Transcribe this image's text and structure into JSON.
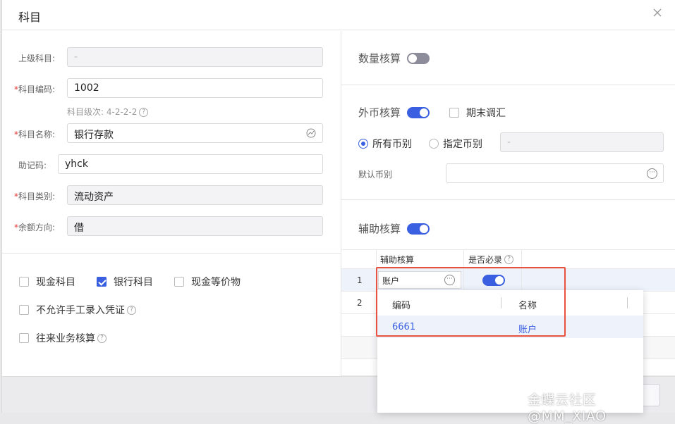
{
  "dialog": {
    "title": "科目"
  },
  "form": {
    "parent": {
      "label": "上级科目:",
      "value": "-"
    },
    "code": {
      "label": "科目编码:",
      "value": "1002",
      "hint": "科目级次: 4-2-2-2"
    },
    "name": {
      "label": "科目名称:",
      "value": "银行存款"
    },
    "mnemonic": {
      "label": "助记码:",
      "value": "yhck"
    },
    "category": {
      "label": "科目类别:",
      "value": "流动资产"
    },
    "balance": {
      "label": "余额方向:",
      "value": "借"
    },
    "required_mark": "*"
  },
  "checks": {
    "cash": {
      "label": "现金科目",
      "checked": false
    },
    "bank": {
      "label": "银行科目",
      "checked": true
    },
    "cash_eq": {
      "label": "现金等价物",
      "checked": false
    },
    "no_manual": {
      "label": "不允许手工录入凭证",
      "checked": false
    },
    "ar_ap": {
      "label": "往来业务核算",
      "checked": false
    }
  },
  "right": {
    "quantity": {
      "label": "数量核算",
      "on": false
    },
    "foreign": {
      "label": "外币核算",
      "on": true
    },
    "period_adjust": {
      "label": "期末调汇",
      "checked": false
    },
    "all_currency": {
      "label": "所有币别",
      "selected": true
    },
    "specific_currency": {
      "label": "指定币别",
      "selected": false,
      "value": "-"
    },
    "default_currency": {
      "label": "默认币别",
      "value": ""
    },
    "aux": {
      "label": "辅助核算",
      "on": true
    }
  },
  "aux_grid": {
    "headers": [
      "辅助核算",
      "是否必录"
    ],
    "rows": [
      {
        "index": "1",
        "value": "账户",
        "required": true
      },
      {
        "index": "2",
        "value": "",
        "required": false
      }
    ]
  },
  "dropdown": {
    "headers": [
      "编码",
      "名称"
    ],
    "rows": [
      {
        "code": "6661",
        "name": "账户"
      }
    ]
  },
  "watermark": "金蝶云社区@MM_XIAO",
  "colors": {
    "accent": "#3a5fe0",
    "highlight": "#e8523f",
    "required": "#e53935"
  }
}
